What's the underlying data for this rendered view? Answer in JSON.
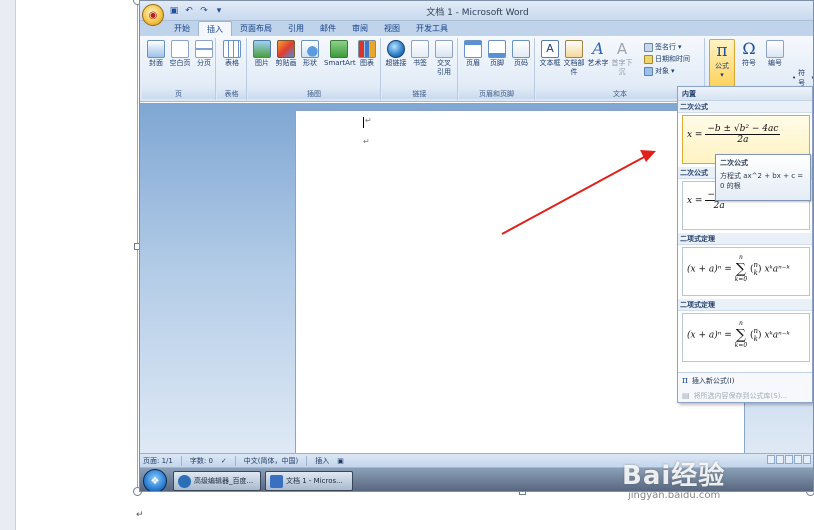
{
  "window": {
    "title": "文档 1 - Microsoft Word",
    "office_button_icon": "office-logo-icon"
  },
  "qat": [
    "save-icon",
    "undo-icon",
    "redo-icon",
    "customize-icon"
  ],
  "tabs": [
    {
      "label": "开始"
    },
    {
      "label": "插入"
    },
    {
      "label": "页面布局"
    },
    {
      "label": "引用"
    },
    {
      "label": "邮件"
    },
    {
      "label": "审阅"
    },
    {
      "label": "视图"
    },
    {
      "label": "开发工具"
    }
  ],
  "active_tab": "插入",
  "ribbon": {
    "pages": {
      "label": "页",
      "cover": "封面",
      "blank": "空白页",
      "break": "分页"
    },
    "tables": {
      "label": "表格",
      "table": "表格"
    },
    "illustrations": {
      "label": "插图",
      "picture": "图片",
      "clipart": "剪贴画",
      "shapes": "形状",
      "smartart": "SmartArt",
      "chart": "图表"
    },
    "links": {
      "label": "链接",
      "hyperlink": "超链接",
      "bookmark": "书签",
      "crossref_1": "交叉",
      "crossref_2": "引用"
    },
    "header_footer": {
      "label": "页眉和页脚",
      "header": "页眉",
      "footer": "页脚",
      "page_number": "页码"
    },
    "text": {
      "label": "文本",
      "textbox": "文本框",
      "quickparts": "文档部件",
      "wordart": "艺术字",
      "dropcap": "首字下沉",
      "signature": "签名行",
      "datetime": "日期和时间",
      "object": "对象"
    },
    "symbols": {
      "equation": "公式",
      "symbol": "符号",
      "numbering": "编号",
      "pi_glyph": "π",
      "omega_glyph": "Ω",
      "symbol_small": "符号"
    }
  },
  "gallery": {
    "header": "内置",
    "sections": [
      {
        "title": "二次公式",
        "lhs": "x =",
        "num": "−b ± √b² − 4ac",
        "den": "2a"
      },
      {
        "title": "二次公式",
        "lhs": "x =",
        "num": "−b ±",
        "den": "2a"
      },
      {
        "title": "二项式定理",
        "lhs": "(x + a)ⁿ =",
        "sum": "∑",
        "upper": "n",
        "lower": "k=0",
        "binom_top": "n",
        "binom_bottom": "k",
        "rhs": "xᵏaⁿ⁻ᵏ"
      },
      {
        "title": "二项式定理",
        "lhs": "(x + a)ⁿ =",
        "sum": "∑",
        "upper": "n",
        "lower": "k=0",
        "binom_top": "n",
        "binom_bottom": "k",
        "rhs": "xᵏaⁿ⁻ᵏ"
      }
    ],
    "insert_new": "插入新公式(I)",
    "save_selection": "将所选内容保存到公式库(S)..."
  },
  "tooltip": {
    "title": "二次公式",
    "body": "方程式 ax^2 + bx + c = 0 的根"
  },
  "statusbar": {
    "page": "页面: 1/1",
    "words": "字数: 0",
    "language": "中文(简体，中国)",
    "mode": "插入"
  },
  "taskbar": {
    "item1": "高级编辑器_百度...",
    "item2": "文档 1 - Micros..."
  },
  "watermark": {
    "logo": "Bai经验",
    "url": "jingyan.baidu.com"
  },
  "paragraph_mark": "↵",
  "colors": {
    "arrow": "#e0201b",
    "ribbon_bg": "#dbe7f5",
    "highlight": "#ffd35c"
  }
}
